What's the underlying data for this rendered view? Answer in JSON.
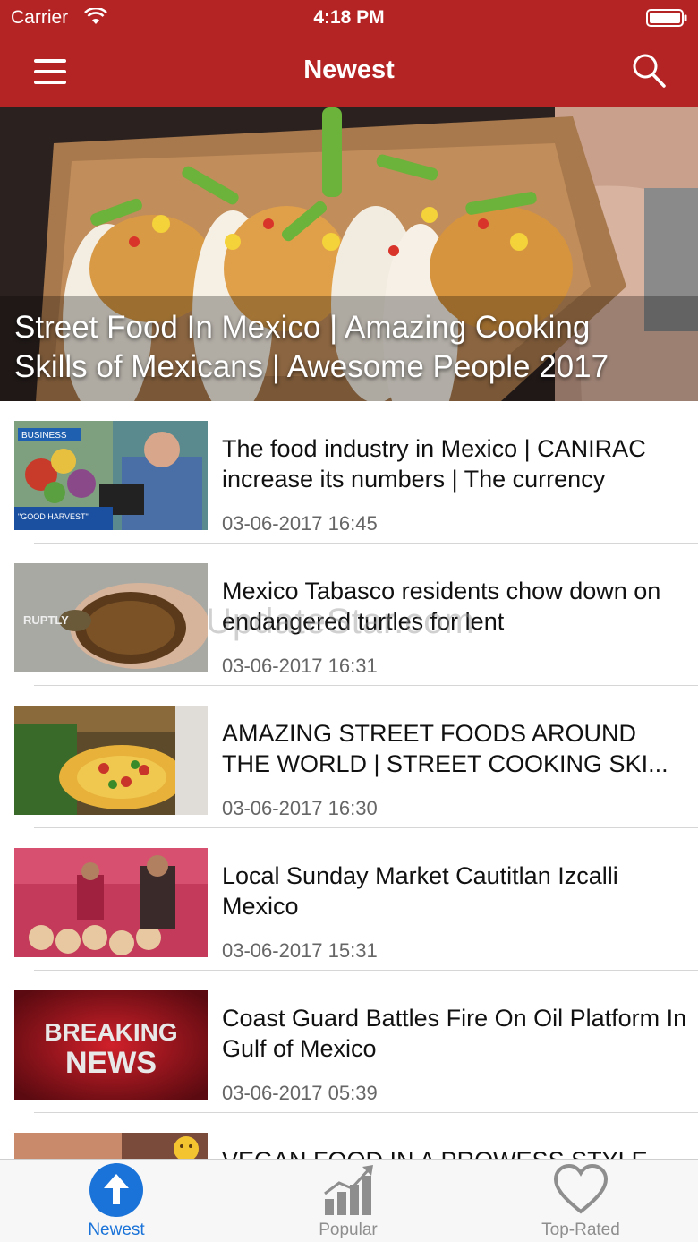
{
  "status_bar": {
    "carrier": "Carrier",
    "time": "4:18 PM"
  },
  "nav": {
    "title": "Newest",
    "menu_icon": "hamburger-menu-icon",
    "search_icon": "search-icon"
  },
  "hero": {
    "title": "Street Food In Mexico | Amazing Cooking Skills of Mexicans | Awesome People 2017"
  },
  "items": [
    {
      "title": "The food industry in Mexico | CANIRAC increase its numbers | The currency",
      "date": "03-06-2017 16:45",
      "thumb_text_top": "BUSINESS",
      "thumb_text_bottom": "\"GOOD HARVEST\""
    },
    {
      "title": "Mexico  Tabasco residents chow down on endangered turtles for lent",
      "date": "03-06-2017 16:31",
      "thumb_text": "RUPTLY"
    },
    {
      "title": "AMAZING STREET FOODS AROUND THE WORLD | STREET COOKING SKI...",
      "date": "03-06-2017 16:30"
    },
    {
      "title": "Local Sunday Market Cautitlan Izcalli Mexico",
      "date": "03-06-2017 15:31"
    },
    {
      "title": "Coast Guard Battles Fire On Oil Platform In Gulf of Mexico",
      "date": "03-06-2017 05:39",
      "thumb_text_1": "BREAKING",
      "thumb_text_2": "NEWS"
    },
    {
      "title": "VEGAN FOOD IN A PROWESS STYLE",
      "date": ""
    }
  ],
  "watermark": "UpdateStar.com",
  "tabs": [
    {
      "label": "Newest",
      "icon": "arrow-up-circle-icon",
      "active": true
    },
    {
      "label": "Popular",
      "icon": "bar-chart-icon",
      "active": false
    },
    {
      "label": "Top-Rated",
      "icon": "heart-icon",
      "active": false
    }
  ],
  "colors": {
    "brand": "#b52424",
    "tab_active": "#1a73d8",
    "tab_inactive": "#8e8e8e"
  }
}
